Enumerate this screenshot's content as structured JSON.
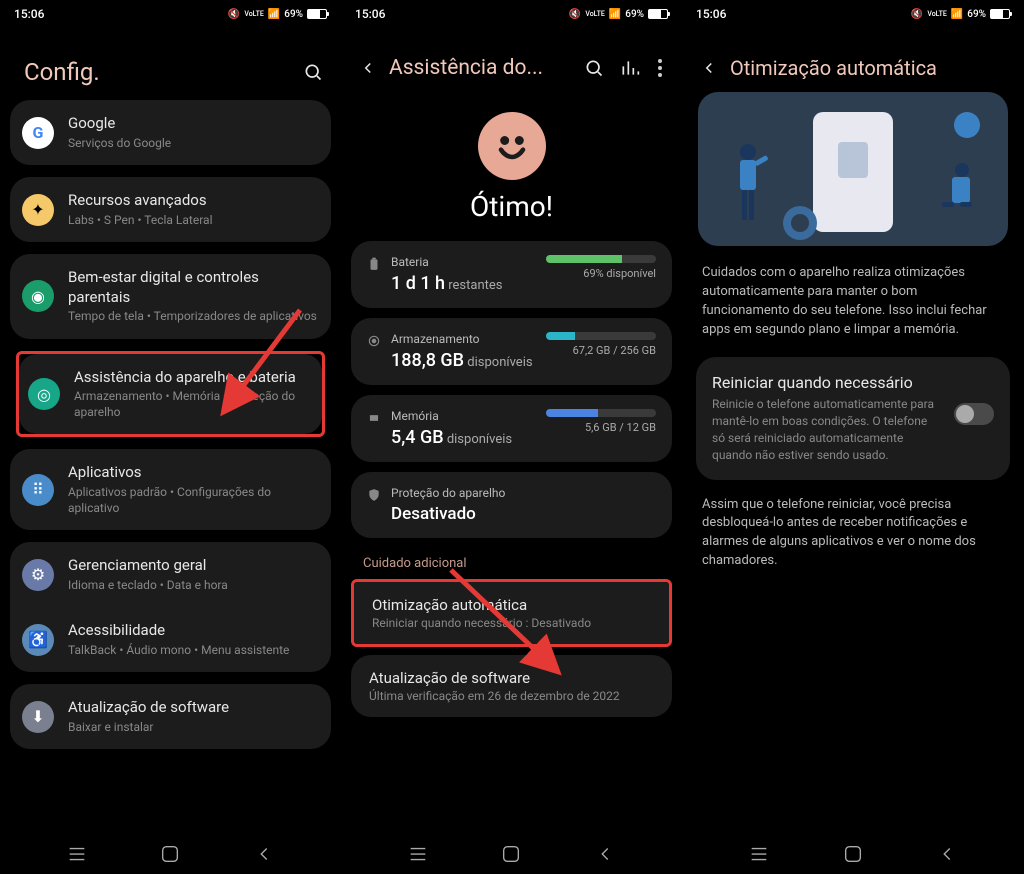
{
  "statusbar": {
    "time": "15:06",
    "net1": "VoLTE",
    "net2": "VoLTE",
    "battery_pct": "69%"
  },
  "screen1": {
    "title": "Config.",
    "groups": {
      "google": {
        "title": "Google",
        "sub": "Serviços do Google"
      },
      "advanced": {
        "title": "Recursos avançados",
        "sub": "Labs • S Pen • Tecla Lateral"
      },
      "wellbeing": {
        "title": "Bem-estar digital e controles parentais",
        "sub": "Tempo de tela • Temporizadores de aplicativos"
      },
      "devicecare": {
        "title": "Assistência do aparelho e bateria",
        "sub": "Armazenamento • Memória • Proteção do aparelho"
      },
      "apps": {
        "title": "Aplicativos",
        "sub": "Aplicativos padrão • Configurações do aplicativo"
      },
      "mgmt": {
        "title": "Gerenciamento geral",
        "sub": "Idioma e teclado • Data e hora"
      },
      "access": {
        "title": "Acessibilidade",
        "sub": "TalkBack • Áudio mono • Menu assistente"
      },
      "update": {
        "title": "Atualização de software",
        "sub": "Baixar e instalar"
      }
    }
  },
  "screen2": {
    "title": "Assistência do...",
    "status": "Ótimo!",
    "battery": {
      "label": "Bateria",
      "value": "1 d 1 h",
      "value_unit": " restantes",
      "right": "69% disponível",
      "fill": 69,
      "color": "#5ec269"
    },
    "storage": {
      "label": "Armazenamento",
      "value": "188,8 GB",
      "value_unit": " disponíveis",
      "right": "67,2 GB / 256 GB",
      "fill": 26,
      "color": "#2bb5c9"
    },
    "memory": {
      "label": "Memória",
      "value": "5,4 GB",
      "value_unit": " disponíveis",
      "right": "5,6 GB / 12 GB",
      "fill": 47,
      "color": "#4a84e0"
    },
    "protection": {
      "label": "Proteção do aparelho",
      "value": "Desativado"
    },
    "section": "Cuidado adicional",
    "autoopt": {
      "title": "Otimização automática",
      "sub": "Reiniciar quando necessário : Desativado"
    },
    "swupdate": {
      "title": "Atualização de software",
      "sub": "Última verificação em 26 de dezembro de 2022"
    }
  },
  "screen3": {
    "title": "Otimização automática",
    "desc1": "Cuidados com o aparelho realiza otimizações automaticamente para manter o bom funcionamento do seu telefone. Isso inclui fechar apps em segundo plano e limpar a memória.",
    "restart": {
      "title": "Reiniciar quando necessário",
      "sub": "Reinicie o telefone automaticamente para mantê-lo em boas condições. O telefone só será reiniciado automaticamente quando não estiver sendo usado."
    },
    "desc2": "Assim que o telefone reiniciar, você precisa desbloqueá-lo antes de receber notificações e alarmes de alguns aplicativos e ver o nome dos chamadores."
  }
}
